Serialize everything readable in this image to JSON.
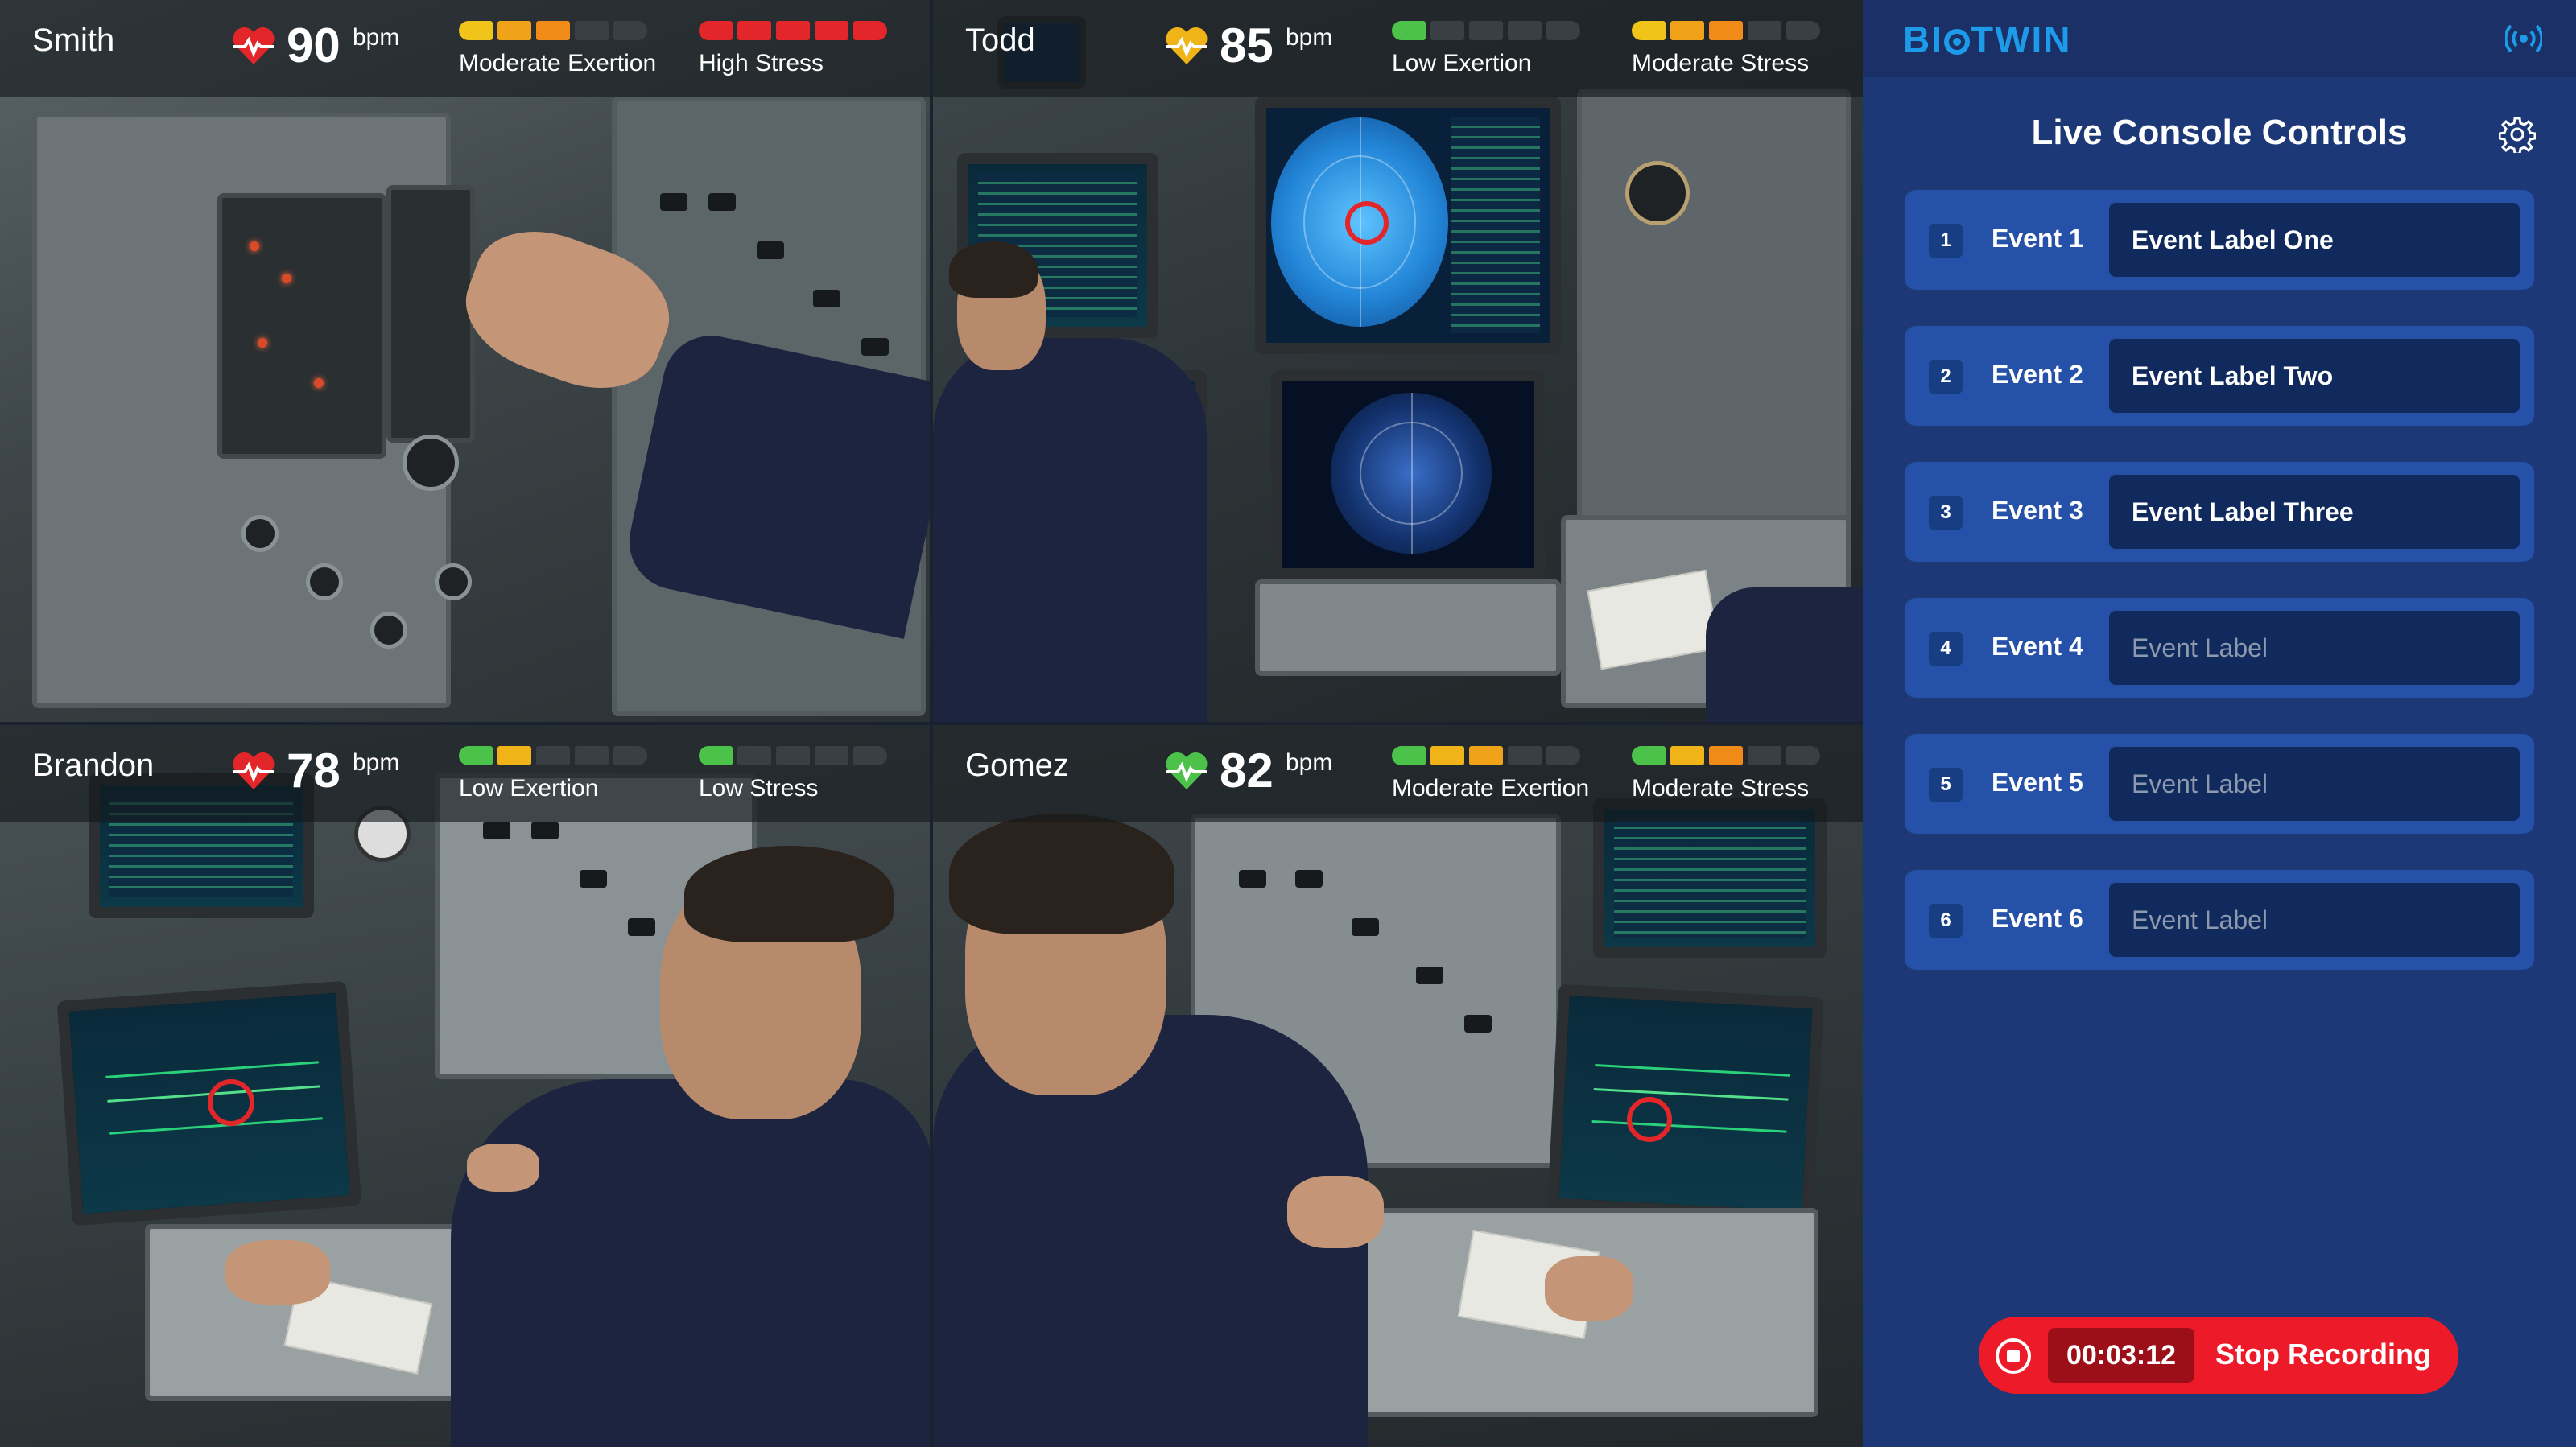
{
  "operators": [
    {
      "name": "Smith",
      "bpm": "90",
      "bpm_unit": "bpm",
      "heart_color": "#e3262a",
      "exertion": {
        "label": "Moderate Exertion",
        "level": 3,
        "colors": [
          "#f0c419",
          "#f0a319",
          "#f08a19"
        ]
      },
      "stress": {
        "label": "High Stress",
        "level": 5,
        "colors": [
          "#e3262a",
          "#e3262a",
          "#e3262a",
          "#e3262a",
          "#e3262a"
        ]
      }
    },
    {
      "name": "Todd",
      "bpm": "85",
      "bpm_unit": "bpm",
      "heart_color": "#f0b419",
      "exertion": {
        "label": "Low Exertion",
        "level": 1,
        "colors": [
          "#4cc24a"
        ]
      },
      "stress": {
        "label": "Moderate Stress",
        "level": 3,
        "colors": [
          "#f0c419",
          "#f0a319",
          "#f08a19"
        ]
      }
    },
    {
      "name": "Brandon",
      "bpm": "78",
      "bpm_unit": "bpm",
      "heart_color": "#e3262a",
      "exertion": {
        "label": "Low Exertion",
        "level": 2,
        "colors": [
          "#4cc24a",
          "#f0b419"
        ]
      },
      "stress": {
        "label": "Low Stress",
        "level": 1,
        "colors": [
          "#4cc24a"
        ]
      }
    },
    {
      "name": "Gomez",
      "bpm": "82",
      "bpm_unit": "bpm",
      "heart_color": "#4cc24a",
      "exertion": {
        "label": "Moderate Exertion",
        "level": 3,
        "colors": [
          "#4cc24a",
          "#f0b419",
          "#f0a319"
        ]
      },
      "stress": {
        "label": "Moderate Stress",
        "level": 3,
        "colors": [
          "#4cc24a",
          "#f0b419",
          "#f08a19"
        ]
      }
    }
  ],
  "sidebar": {
    "logo": "BIOTWIN",
    "title": "Live Console Controls",
    "events": [
      {
        "num": "1",
        "name": "Event 1",
        "label": "Event Label One",
        "placeholder": "Event Label"
      },
      {
        "num": "2",
        "name": "Event 2",
        "label": "Event Label Two",
        "placeholder": "Event Label"
      },
      {
        "num": "3",
        "name": "Event 3",
        "label": "Event Label Three",
        "placeholder": "Event Label"
      },
      {
        "num": "4",
        "name": "Event 4",
        "label": "",
        "placeholder": "Event Label"
      },
      {
        "num": "5",
        "name": "Event 5",
        "label": "",
        "placeholder": "Event Label"
      },
      {
        "num": "6",
        "name": "Event 6",
        "label": "",
        "placeholder": "Event Label"
      }
    ]
  },
  "recording": {
    "time": "00:03:12",
    "label": "Stop Recording"
  },
  "meter_segments": 5,
  "colors": {
    "sidebar": "#1c3876",
    "event_card": "#2552a8",
    "record": "#ed1b2a",
    "logo": "#1e9be8"
  }
}
